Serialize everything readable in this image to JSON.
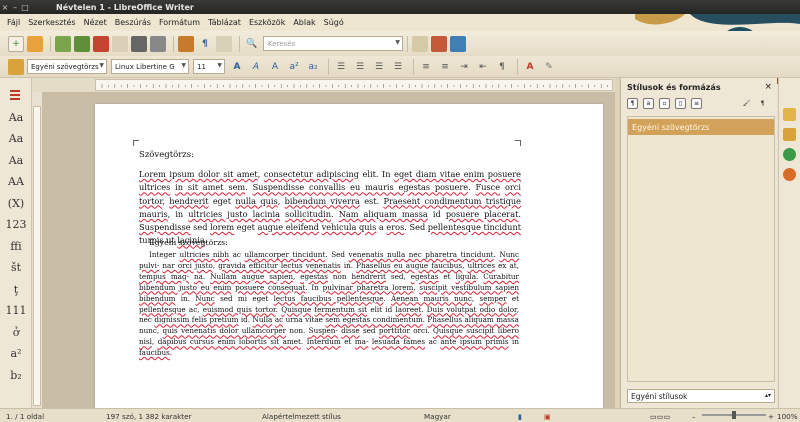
{
  "window": {
    "title": "Névtelen 1 - LibreOffice Writer",
    "controls": [
      "×",
      "–",
      "□"
    ]
  },
  "menu": [
    "Fájl",
    "Szerkesztés",
    "Nézet",
    "Beszúrás",
    "Formátum",
    "Táblázat",
    "Eszközök",
    "Ablak",
    "Súgó"
  ],
  "toolbar": {
    "search_placeholder": "Keresés",
    "paragraph_style": "Egyéni szövegtörzs",
    "font_name": "Linux Libertine G",
    "font_size": "11"
  },
  "left_styles": [
    "Aa",
    "Aa",
    "Aa",
    "AA",
    "(X)",
    "123",
    "ffi",
    "št",
    "ţ",
    "111",
    "ở",
    "a²",
    "b₂"
  ],
  "document": {
    "heading1": "Szövegtörzs:",
    "para1": [
      {
        "t": "Lorem ipsum dolor sit amet",
        "w": true
      },
      {
        "t": ", ",
        "w": false
      },
      {
        "t": "consectetur adipiscing",
        "w": true
      },
      {
        "t": " elit. In ",
        "w": false
      },
      {
        "t": "eget diam vitae enim posuere ultrices",
        "w": true
      },
      {
        "t": " ",
        "w": false
      },
      {
        "t": "in sit amet sem",
        "w": true
      },
      {
        "t": ". ",
        "w": false
      },
      {
        "t": "Suspendisse convallis eu mauris egestas posuere",
        "w": true
      },
      {
        "t": ". ",
        "w": false
      },
      {
        "t": "Fusce",
        "w": true
      },
      {
        "t": " ",
        "w": false
      },
      {
        "t": "orci tortor",
        "w": true
      },
      {
        "t": ", ",
        "w": false
      },
      {
        "t": "hendrerit",
        "w": true
      },
      {
        "t": " eget ",
        "w": false
      },
      {
        "t": "nulla quis",
        "w": true
      },
      {
        "t": ", ",
        "w": false
      },
      {
        "t": "bibendum viverra",
        "w": true
      },
      {
        "t": " est. ",
        "w": false
      },
      {
        "t": "Praesent condimentum tristique mauris",
        "w": true
      },
      {
        "t": ", in ",
        "w": false
      },
      {
        "t": "ultricies justo lacinia",
        "w": true
      },
      {
        "t": " ",
        "w": false
      },
      {
        "t": "sollicitudin",
        "w": true
      },
      {
        "t": ". ",
        "w": false
      },
      {
        "t": "Nam aliquam massa",
        "w": true
      },
      {
        "t": " id ",
        "w": false
      },
      {
        "t": "posuere placerat",
        "w": true
      },
      {
        "t": ". ",
        "w": false
      },
      {
        "t": "Suspendisse",
        "w": true
      },
      {
        "t": " sed ",
        "w": false
      },
      {
        "t": "lorem",
        "w": true
      },
      {
        "t": " eget ",
        "w": false
      },
      {
        "t": "augue eleifend",
        "w": true
      },
      {
        "t": " ",
        "w": false
      },
      {
        "t": "vehicula quis",
        "w": true
      },
      {
        "t": " a ",
        "w": false
      },
      {
        "t": "eros",
        "w": true
      },
      {
        "t": ". Sed ",
        "w": false
      },
      {
        "t": "pellentesque tincidunt",
        "w": true
      },
      {
        "t": " turpis ut ",
        "w": false
      },
      {
        "t": "lacinia",
        "w": true
      },
      {
        "t": ".",
        "w": false
      }
    ],
    "heading2": "Egyéni szövegtörzs:",
    "para2": [
      {
        "t": "Integer ",
        "w": false
      },
      {
        "t": "ultricies nibh",
        "w": true
      },
      {
        "t": " ac ",
        "w": false
      },
      {
        "t": "ullamcorper tincidunt",
        "w": true
      },
      {
        "t": ". Sed ",
        "w": false
      },
      {
        "t": "venenatis nulla nec pharetra tincidunt",
        "w": true
      },
      {
        "t": ". ",
        "w": false
      },
      {
        "t": "Nunc pulvi-",
        "w": true
      },
      {
        "t": " ",
        "w": false
      },
      {
        "t": "nar orci justo",
        "w": true
      },
      {
        "t": ", ",
        "w": false
      },
      {
        "t": "gravida efficitur lectus venenatis",
        "w": true
      },
      {
        "t": " in. ",
        "w": false
      },
      {
        "t": "Phasellus eu augue faucibus",
        "w": true
      },
      {
        "t": ", ",
        "w": false
      },
      {
        "t": "ultrices",
        "w": true
      },
      {
        "t": " ex at, ",
        "w": false
      },
      {
        "t": "tempus mag-",
        "w": true
      },
      {
        "t": " ",
        "w": false
      },
      {
        "t": "na",
        "w": true
      },
      {
        "t": ". ",
        "w": false
      },
      {
        "t": "Nullam augue sapien",
        "w": true
      },
      {
        "t": ", ",
        "w": false
      },
      {
        "t": "egestas",
        "w": true
      },
      {
        "t": " non ",
        "w": false
      },
      {
        "t": "hendrerit",
        "w": true
      },
      {
        "t": " sed, ",
        "w": false
      },
      {
        "t": "egestas",
        "w": true
      },
      {
        "t": " et ",
        "w": false
      },
      {
        "t": "ligula",
        "w": true
      },
      {
        "t": ". ",
        "w": false
      },
      {
        "t": "Curabitur bibendum justo eu enim",
        "w": true
      },
      {
        "t": " ",
        "w": false
      },
      {
        "t": "posuere consequat",
        "w": true
      },
      {
        "t": ". In ",
        "w": false
      },
      {
        "t": "pulvinar pharetra lorem",
        "w": true
      },
      {
        "t": ", ",
        "w": false
      },
      {
        "t": "suscipit vestibulum sapien bibendum",
        "w": true
      },
      {
        "t": " in. ",
        "w": false
      },
      {
        "t": "Nunc",
        "w": true
      },
      {
        "t": " sed mi eget ",
        "w": false
      },
      {
        "t": "lectus faucibus pellentesque",
        "w": true
      },
      {
        "t": ". ",
        "w": false
      },
      {
        "t": "Aenean mauris nunc",
        "w": true
      },
      {
        "t": ", ",
        "w": false
      },
      {
        "t": "semper",
        "w": true
      },
      {
        "t": " et ",
        "w": false
      },
      {
        "t": "pellentesque",
        "w": true
      },
      {
        "t": " ac, ",
        "w": false
      },
      {
        "t": "euismod quis tortor",
        "w": true
      },
      {
        "t": ". ",
        "w": false
      },
      {
        "t": "Quisque",
        "w": true
      },
      {
        "t": " ",
        "w": false
      },
      {
        "t": "fermentum sit",
        "w": true
      },
      {
        "t": " elit id ",
        "w": false
      },
      {
        "t": "laoreet",
        "w": true
      },
      {
        "t": ". ",
        "w": false
      },
      {
        "t": "Duis volutpat odio dolor",
        "w": true
      },
      {
        "t": ", nec ",
        "w": false
      },
      {
        "t": "dignissim felis pretium",
        "w": true
      },
      {
        "t": " id. ",
        "w": false
      },
      {
        "t": "Nulla",
        "w": true
      },
      {
        "t": " ",
        "w": false
      },
      {
        "t": "ac",
        "w": true
      },
      {
        "t": " urna vitae ",
        "w": false
      },
      {
        "t": "sem egestas condimentum",
        "w": true
      },
      {
        "t": ". ",
        "w": false
      },
      {
        "t": "Phasellus aliquam massa",
        "w": true
      },
      {
        "t": " nunc, ",
        "w": false
      },
      {
        "t": "quis venenatis dolor ullamcorper",
        "w": true
      },
      {
        "t": " non. ",
        "w": false
      },
      {
        "t": "Suspen-",
        "w": true
      },
      {
        "t": " ",
        "w": false
      },
      {
        "t": "disse",
        "w": true
      },
      {
        "t": " sed ",
        "w": false
      },
      {
        "t": "porttitor",
        "w": true
      },
      {
        "t": " orci. ",
        "w": false
      },
      {
        "t": "Quisque suscipit libero nisl",
        "w": true
      },
      {
        "t": ", ",
        "w": false
      },
      {
        "t": "dapibus cursus enim lobortis sit amet",
        "w": true
      },
      {
        "t": ". ",
        "w": false
      },
      {
        "t": "Interdum",
        "w": true
      },
      {
        "t": " et ",
        "w": false
      },
      {
        "t": "ma-",
        "w": true
      },
      {
        "t": " ",
        "w": false
      },
      {
        "t": "lesuada fames",
        "w": true
      },
      {
        "t": " ac ",
        "w": false
      },
      {
        "t": "ante ipsum primis",
        "w": true
      },
      {
        "t": " in ",
        "w": false
      },
      {
        "t": "faucibus",
        "w": true
      },
      {
        "t": ".",
        "w": false
      }
    ]
  },
  "sidebar": {
    "title": "Stílusok és formázás",
    "selected_style": "Egyéni szövegtörzs",
    "filter": "Egyéni stílusok"
  },
  "status": {
    "page": "1. / 1 oldal",
    "words": "197 szó, 1 382 karakter",
    "style": "Alapértelmezett stílus",
    "lang": "Magyar",
    "zoom": "100%",
    "zoom_fraction": 0.5
  },
  "colors": {
    "accent": "#d3a25a",
    "chrome": "#efe7d5",
    "titlebar": "#2f2f2d"
  }
}
